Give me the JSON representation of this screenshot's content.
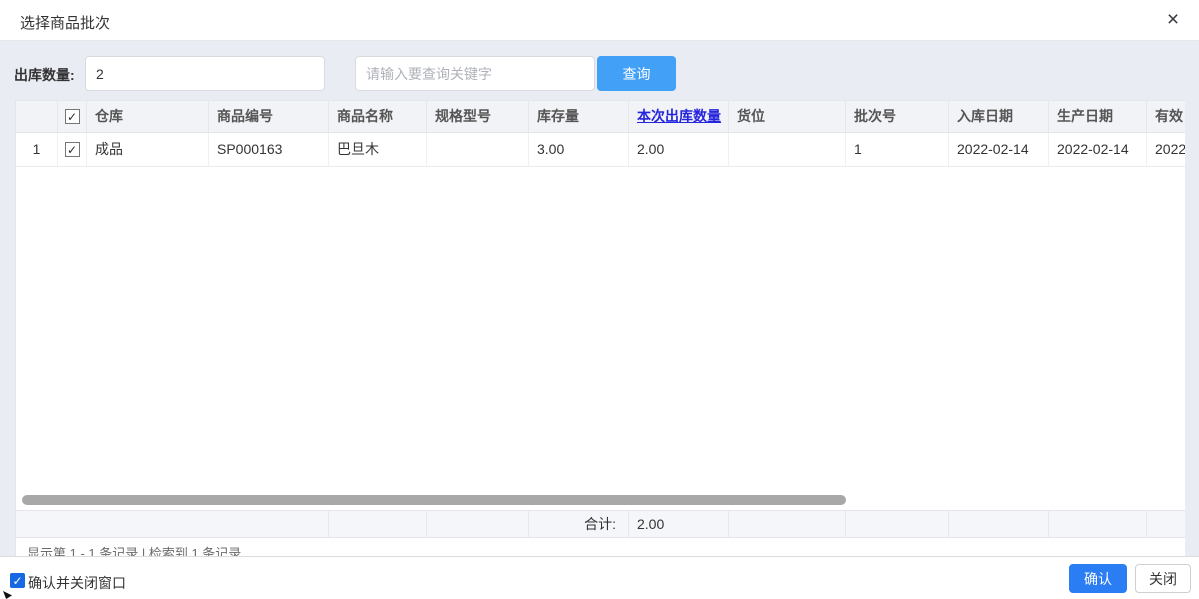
{
  "dialog": {
    "title": "选择商品批次",
    "close_icon": "×"
  },
  "form": {
    "quantity_label": "出库数量:",
    "quantity_value": "2",
    "search_placeholder": "请输入要查询关键字",
    "query_button": "查询"
  },
  "table": {
    "columns": [
      {
        "label": ""
      },
      {
        "label": "checkbox",
        "checked": true
      },
      {
        "label": "仓库"
      },
      {
        "label": "商品编号"
      },
      {
        "label": "商品名称"
      },
      {
        "label": "规格型号"
      },
      {
        "label": "库存量"
      },
      {
        "label": "本次出库数量"
      },
      {
        "label": "货位"
      },
      {
        "label": "批次号"
      },
      {
        "label": "入库日期"
      },
      {
        "label": "生产日期"
      },
      {
        "label": "有效"
      }
    ],
    "rows": [
      {
        "index": "1",
        "checked": true,
        "warehouse": "成品",
        "product_code": "SP000163",
        "product_name": "巴旦木",
        "spec_model": "",
        "stock_qty": "3.00",
        "outbound_qty": "2.00",
        "location": "",
        "batch_no": "1",
        "inbound_date": "2022-02-14",
        "production_date": "2022-02-14",
        "validity_date": "2022"
      }
    ],
    "summary": {
      "total_label": "合计:",
      "total_value": "2.00"
    },
    "pager_info": "显示第 1 - 1 条记录 | 检索到 1 条记录"
  },
  "footer": {
    "confirm_close_label": "确认并关闭窗口",
    "confirm_close_checked": true,
    "confirm_button": "确认",
    "close_button": "关闭"
  },
  "icons": {
    "check_glyph": "✓"
  },
  "colors": {
    "query_button_blue": "#42a0f6",
    "confirm_button_blue": "#2a7df2",
    "outbound_header_blue": "#2525dd",
    "content_background": "#e9ecf2",
    "header_background": "#f2f3f6",
    "scrollbar_thumb": "#a8a8a8"
  }
}
